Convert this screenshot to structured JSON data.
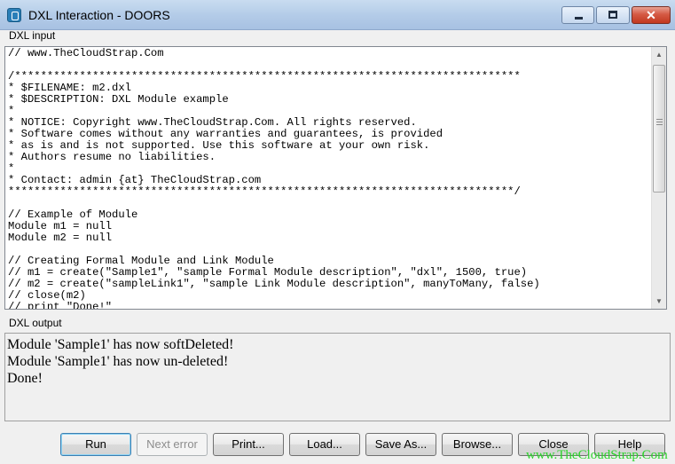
{
  "window": {
    "title": "DXL Interaction - DOORS",
    "icon": "doors-app-icon",
    "controls": {
      "minimize": "minimize-icon",
      "maximize": "maximize-icon",
      "close": "close-icon"
    }
  },
  "input": {
    "label": "DXL input",
    "code": "// www.TheCloudStrap.Com\n\n/******************************************************************************\n* $FILENAME: m2.dxl\n* $DESCRIPTION: DXL Module example\n*\n* NOTICE: Copyright www.TheCloudStrap.Com. All rights reserved.\n* Software comes without any warranties and guarantees, is provided\n* as is and is not supported. Use this software at your own risk.\n* Authors resume no liabilities.\n*\n* Contact: admin {at} TheCloudStrap.com\n******************************************************************************/\n\n// Example of Module\nModule m1 = null\nModule m2 = null\n\n// Creating Formal Module and Link Module\n// m1 = create(\"Sample1\", \"sample Formal Module description\", \"dxl\", 1500, true)\n// m2 = create(\"sampleLink1\", \"sample Link Module description\", manyToMany, false)\n// close(m2)\n// print \"Done!\""
  },
  "output": {
    "label": "DXL output",
    "lines": [
      "Module 'Sample1' has now softDeleted!",
      "Module 'Sample1' has now un-deleted!",
      "Done!"
    ]
  },
  "buttons": {
    "run": "Run",
    "next_error": "Next error",
    "print": "Print...",
    "load": "Load...",
    "save_as": "Save As...",
    "browse": "Browse...",
    "close": "Close",
    "help": "Help"
  },
  "watermark": "www.TheCloudStrap.Com",
  "colors": {
    "titlebar": "#b4cce8",
    "close_button": "#c2381f",
    "watermark": "#2ad32a",
    "default_button_border": "#3c7fb1"
  }
}
